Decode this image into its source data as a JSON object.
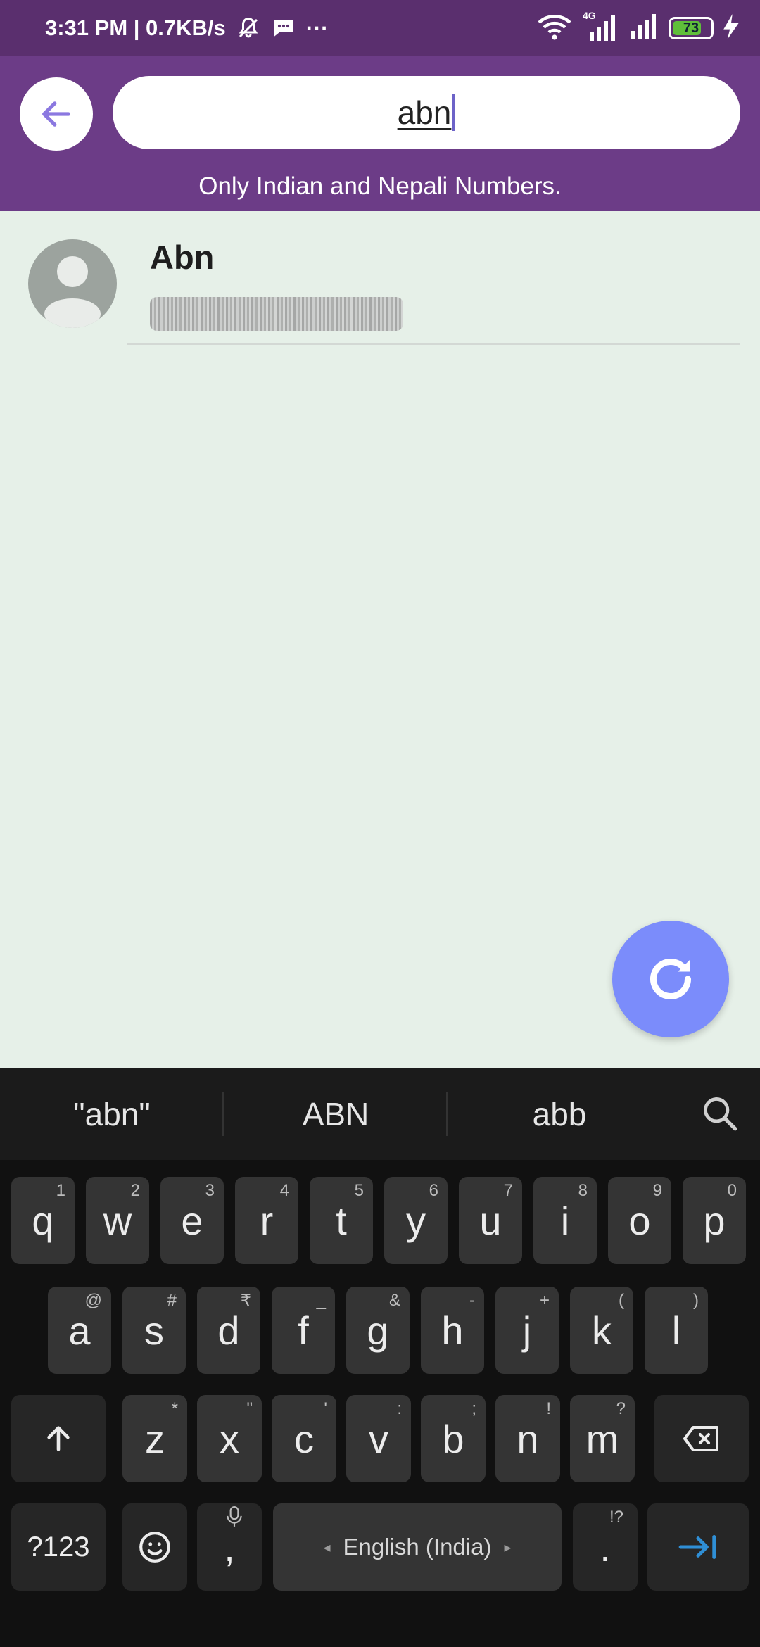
{
  "status_bar": {
    "time_speed": "3:31 PM | 0.7KB/s",
    "more_dots": "···",
    "network_label": "4G",
    "battery_level": "73"
  },
  "header": {
    "search_value": "abn",
    "subtitle": "Only Indian and Nepali Numbers."
  },
  "results": [
    {
      "name": "Abn"
    }
  ],
  "keyboard": {
    "suggestions": [
      "\"abn\"",
      "ABN",
      "abb"
    ],
    "row1": [
      {
        "label": "q",
        "sub": "1"
      },
      {
        "label": "w",
        "sub": "2"
      },
      {
        "label": "e",
        "sub": "3"
      },
      {
        "label": "r",
        "sub": "4"
      },
      {
        "label": "t",
        "sub": "5"
      },
      {
        "label": "y",
        "sub": "6"
      },
      {
        "label": "u",
        "sub": "7"
      },
      {
        "label": "i",
        "sub": "8"
      },
      {
        "label": "o",
        "sub": "9"
      },
      {
        "label": "p",
        "sub": "0"
      }
    ],
    "row2": [
      {
        "label": "a",
        "sub": "@"
      },
      {
        "label": "s",
        "sub": "#"
      },
      {
        "label": "d",
        "sub": "₹"
      },
      {
        "label": "f",
        "sub": "_"
      },
      {
        "label": "g",
        "sub": "&"
      },
      {
        "label": "h",
        "sub": "-"
      },
      {
        "label": "j",
        "sub": "+"
      },
      {
        "label": "k",
        "sub": "("
      },
      {
        "label": "l",
        "sub": ")"
      }
    ],
    "row3": [
      {
        "label": "z",
        "sub": "*"
      },
      {
        "label": "x",
        "sub": "\""
      },
      {
        "label": "c",
        "sub": "'"
      },
      {
        "label": "v",
        "sub": ":"
      },
      {
        "label": "b",
        "sub": ";"
      },
      {
        "label": "n",
        "sub": "!"
      },
      {
        "label": "m",
        "sub": "?"
      }
    ],
    "symbols_key": "?123",
    "comma": ",",
    "space_label": "English (India)",
    "period": ".",
    "period_sub": "!?",
    "colors": {
      "accent": "#2f8fd6",
      "fab": "#7b8cfb",
      "header": "#6c3c87"
    }
  }
}
